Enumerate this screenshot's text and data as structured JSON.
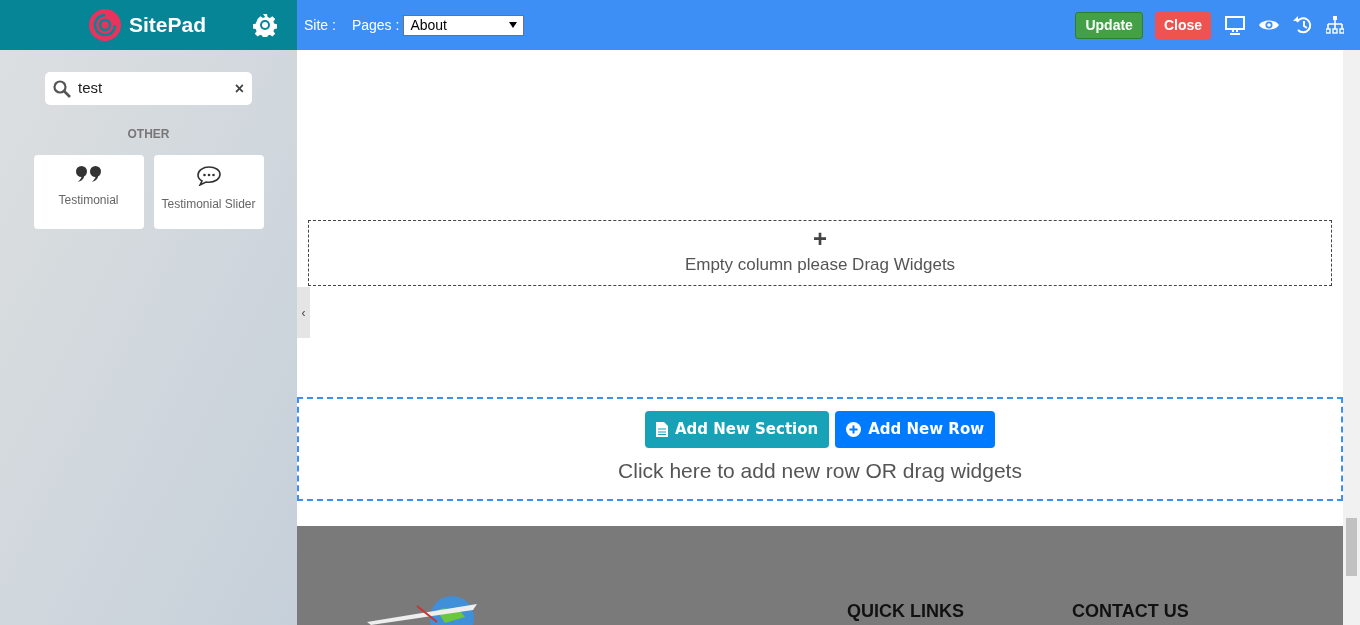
{
  "sidebar": {
    "brand": "SitePad",
    "search": {
      "value": "test",
      "clear": "×"
    },
    "category": "OTHER",
    "widgets": [
      {
        "kind": "quote",
        "label": "Testimonial"
      },
      {
        "kind": "chat",
        "label": "Testimonial Slider"
      }
    ],
    "collapse": "‹"
  },
  "toolbar": {
    "site_label": "Site :",
    "pages_label": "Pages :",
    "page_select": "About",
    "buttons": [
      {
        "kind": "update",
        "label": "Update"
      },
      {
        "kind": "close",
        "label": "Close"
      }
    ]
  },
  "canvas": {
    "empty_column": {
      "plus": "+",
      "text": "Empty column please Drag Widgets"
    },
    "add_area": {
      "buttons": [
        {
          "kind": "section",
          "label": "Add New Section"
        },
        {
          "kind": "row",
          "label": "Add New Row"
        }
      ],
      "hint": "Click here to add new row OR drag widgets"
    },
    "footer": {
      "headings": [
        "QUICK LINKS",
        "CONTACT US"
      ]
    }
  }
}
